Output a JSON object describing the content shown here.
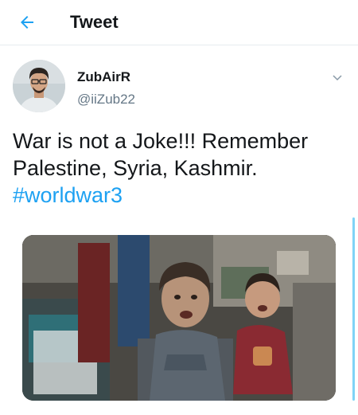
{
  "header": {
    "title": "Tweet",
    "back_icon": "arrow-left-icon",
    "accent": "#1da1f2"
  },
  "tweet": {
    "display_name": "ZubAirR",
    "handle": "@iiZub22",
    "text_line1": "War is not a Joke!!! Remember",
    "text_line2": "Palestine, Syria, Kashmir.",
    "hashtag": "#worldwar3",
    "more_icon": "chevron-down-icon",
    "media_icon": "photo"
  },
  "colors": {
    "text": "#14171a",
    "secondary": "#657786",
    "link": "#1da1f2",
    "divider": "#e6ecf0"
  }
}
